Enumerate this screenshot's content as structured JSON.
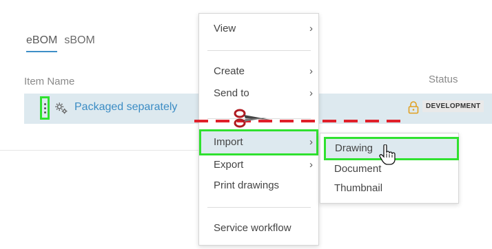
{
  "tabs": [
    {
      "label": "eBOM",
      "active": true
    },
    {
      "label": "sBOM",
      "active": false
    }
  ],
  "columns": {
    "item_name": "Item Name",
    "status": "Status"
  },
  "row": {
    "item_name": "Packaged separately",
    "status": "DEVELOPMENT",
    "icon": "gear-icon",
    "status_icon": "lock-icon"
  },
  "menu": {
    "items": [
      {
        "label": "View",
        "has_submenu": true
      },
      {
        "label": "Create",
        "has_submenu": true
      },
      {
        "label": "Send to",
        "has_submenu": true
      },
      {
        "label": "Import",
        "has_submenu": true,
        "highlighted": true
      },
      {
        "label": "Export",
        "has_submenu": true
      },
      {
        "label": "Print drawings",
        "has_submenu": false
      },
      {
        "label": "Service workflow",
        "has_submenu": false
      }
    ],
    "chevron": "›"
  },
  "submenu": {
    "items": [
      {
        "label": "Drawing",
        "highlighted": true
      },
      {
        "label": "Document"
      },
      {
        "label": "Thumbnail"
      }
    ]
  },
  "colors": {
    "link": "#3b8cc4",
    "row_bg": "#dde9ef",
    "highlight_border": "#2fe12f",
    "cut_line": "#e0202a"
  }
}
